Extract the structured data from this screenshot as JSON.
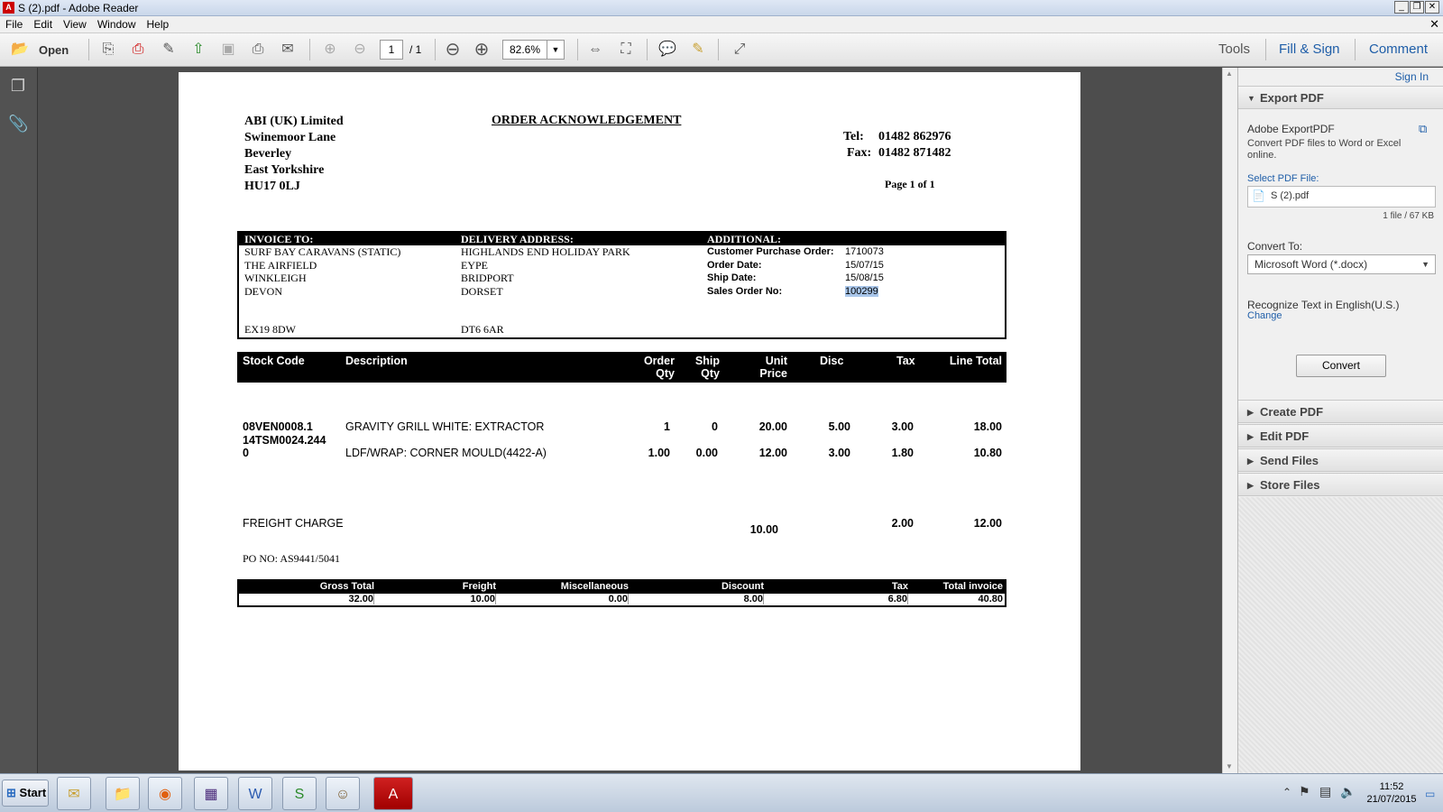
{
  "window": {
    "title": "S (2).pdf - Adobe Reader"
  },
  "menu": [
    "File",
    "Edit",
    "View",
    "Window",
    "Help"
  ],
  "toolbar": {
    "open_label": "Open",
    "page_current": "1",
    "page_total": "/ 1",
    "zoom": "82.6%",
    "tools": "Tools",
    "fill_sign": "Fill & Sign",
    "comment": "Comment"
  },
  "doc": {
    "company": [
      "ABI (UK) Limited",
      "Swinemoor Lane",
      "Beverley",
      "East Yorkshire",
      "HU17 0LJ"
    ],
    "heading": "ORDER ACKNOWLEDGEMENT",
    "tel_label": "Tel:",
    "tel": "01482 862976",
    "fax_label": "Fax:",
    "fax": "01482 871482",
    "page_info": "Page 1 of 1",
    "invoice_to_label": "INVOICE TO:",
    "delivery_label": "DELIVERY ADDRESS:",
    "additional_label": "ADDITIONAL:",
    "invoice_to": [
      "SURF BAY CARAVANS (STATIC)",
      "THE AIRFIELD",
      "WINKLEIGH",
      "DEVON"
    ],
    "invoice_postcode": "EX19 8DW",
    "delivery": [
      "HIGHLANDS END HOLIDAY PARK",
      "EYPE",
      "BRIDPORT",
      "DORSET"
    ],
    "delivery_postcode": "DT6 6AR",
    "additional": [
      {
        "label": "Customer Purchase Order:",
        "value": "1710073"
      },
      {
        "label": "Order Date:",
        "value": "15/07/15"
      },
      {
        "label": "Ship Date:",
        "value": "15/08/15"
      },
      {
        "label": "Sales Order No:",
        "value": "100299"
      }
    ],
    "columns": {
      "stock_code": "Stock Code",
      "description": "Description",
      "order_qty": [
        "Order",
        "Qty"
      ],
      "ship_qty": [
        "Ship",
        "Qty"
      ],
      "unit_price": [
        "Unit",
        "Price"
      ],
      "disc": "Disc",
      "tax": "Tax",
      "line_total": "Line Total"
    },
    "lines": [
      {
        "code": "08VEN0008.1",
        "desc": "GRAVITY GRILL WHITE: EXTRACTOR",
        "oqty": "1",
        "sqty": "0",
        "price": "20.00",
        "disc": "5.00",
        "tax": "3.00",
        "total": "18.00"
      },
      {
        "code": "14TSM0024.244",
        "code2": "0",
        "desc": "LDF/WRAP: CORNER MOULD(4422-A)",
        "oqty": "1.00",
        "sqty": "0.00",
        "price": "12.00",
        "disc": "3.00",
        "tax": "1.80",
        "total": "10.80"
      }
    ],
    "freight": {
      "label": "FREIGHT CHARGE",
      "price": "10.00",
      "tax": "2.00",
      "total": "12.00"
    },
    "po_no": "PO NO: AS9441/5041",
    "totals": {
      "labels": [
        "Gross Total",
        "Freight",
        "Miscellaneous",
        "Discount",
        "Tax",
        "Total invoice"
      ],
      "values": [
        "32.00",
        "10.00",
        "0.00",
        "8.00",
        "6.80",
        "40.80"
      ]
    }
  },
  "panel": {
    "sign_in": "Sign In",
    "export_pdf": "Export PDF",
    "adobe_export": "Adobe ExportPDF",
    "export_desc": "Convert PDF files to Word or Excel online.",
    "select_label": "Select PDF File:",
    "file_name": "S (2).pdf",
    "file_info": "1 file / 67 KB",
    "convert_to_label": "Convert To:",
    "convert_to_value": "Microsoft Word (*.docx)",
    "recognize": "Recognize Text in English(U.S.)",
    "change": "Change",
    "convert_button": "Convert",
    "sections": [
      "Create PDF",
      "Edit PDF",
      "Send Files",
      "Store Files"
    ]
  },
  "taskbar": {
    "start": "Start",
    "time": "11:52",
    "date": "21/07/2015"
  },
  "colors": {
    "accent_blue": "#1f5ea8",
    "highlight": "#a9c6ea",
    "pdf_red": "#c00000"
  }
}
